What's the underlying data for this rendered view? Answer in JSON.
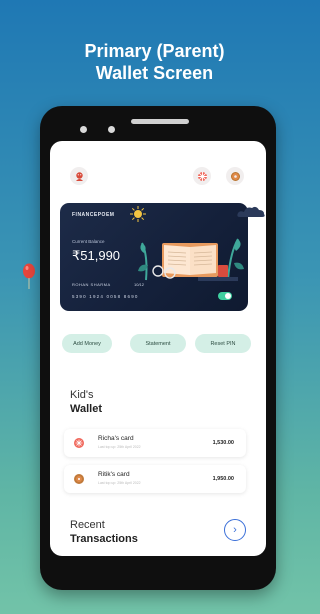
{
  "headline": {
    "line1": "Primary (Parent)",
    "line2": "Wallet Screen"
  },
  "card": {
    "brand": "FINANCEPOEM",
    "balance_label": "Current Balance",
    "balance": "₹51,990",
    "holder": "ROHAN SHARMA",
    "expiry": "10/12",
    "number": "5390 1924 0058 8690"
  },
  "actions": [
    "Add Money",
    "Statement",
    "Reset PIN"
  ],
  "kids_wallet": {
    "title_light": "Kid's",
    "title_bold": "Wallet",
    "cards": [
      {
        "name": "Richa's card",
        "sub": "Last top up: 25th April 2022",
        "amount": "1,530.00"
      },
      {
        "name": "Ritik's card",
        "sub": "Last top up: 25th April 2022",
        "amount": "1,950.00"
      }
    ]
  },
  "recent": {
    "title_light": "Recent",
    "title_bold": "Transactions"
  },
  "icons": {
    "header_left": "avatar-icon",
    "header_right1": "flower-icon",
    "header_right2": "donut-icon",
    "arrow": "chevron-right-icon"
  },
  "colors": {
    "bg_top": "#1f78b4",
    "bg_bottom": "#72c3a8",
    "pill": "#d4efe6",
    "card": "#1d2b48",
    "accent": "#3a6fd8"
  }
}
